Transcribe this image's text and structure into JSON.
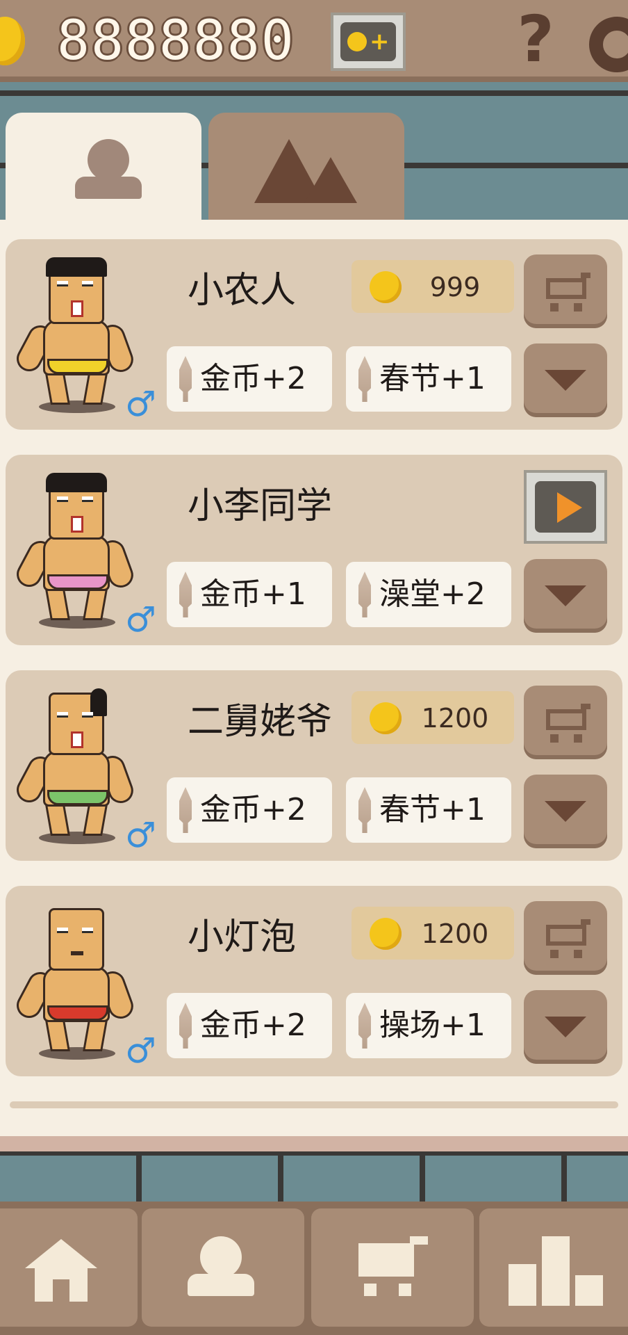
{
  "header": {
    "coin_count": "8888880"
  },
  "tabs": [
    {
      "name": "characters",
      "icon": "person-icon",
      "selected": true
    },
    {
      "name": "scenes",
      "icon": "mountain-icon",
      "selected": false
    }
  ],
  "characters": [
    {
      "name": "小农人",
      "price": "999",
      "action": "buy",
      "shorts_color": "#f0d22a",
      "bonus": [
        "金币+2",
        "春节+1"
      ]
    },
    {
      "name": "小李同学",
      "price": null,
      "action": "watch-video",
      "shorts_color": "#e895c8",
      "bonus": [
        "金币+1",
        "澡堂+2"
      ]
    },
    {
      "name": "二舅姥爷",
      "price": "1200",
      "action": "buy",
      "shorts_color": "#7cc46a",
      "bonus": [
        "金币+2",
        "春节+1"
      ]
    },
    {
      "name": "小灯泡",
      "price": "1200",
      "action": "buy",
      "shorts_color": "#d83a2c",
      "bonus": [
        "金币+2",
        "操场+1"
      ]
    }
  ],
  "bottom_nav": [
    {
      "name": "home",
      "icon": "house-icon"
    },
    {
      "name": "characters",
      "icon": "person-icon"
    },
    {
      "name": "shop",
      "icon": "cart-icon"
    },
    {
      "name": "ranking",
      "icon": "bar-chart-icon"
    }
  ],
  "colors": {
    "coin": "#f4c51b",
    "male_sign": "#3a8fd9",
    "panel_bg": "#f6efe3",
    "card_bg": "#dccbb6",
    "button_brown": "#a88c76"
  }
}
